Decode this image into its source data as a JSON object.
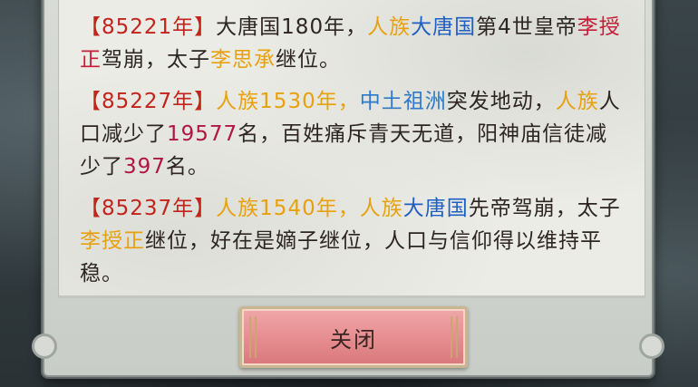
{
  "entries": [
    {
      "segments": [
        {
          "text": "【85221年】",
          "style": "yr"
        },
        {
          "text": "大唐国180年，",
          "style": "plain"
        },
        {
          "text": "人族",
          "style": "race"
        },
        {
          "text": "大唐国",
          "style": "nation"
        },
        {
          "text": "第4世皇帝",
          "style": "plain"
        },
        {
          "text": "李授正",
          "style": "person"
        },
        {
          "text": "驾崩，太子",
          "style": "plain"
        },
        {
          "text": "李思承",
          "style": "race"
        },
        {
          "text": "继位。",
          "style": "plain"
        }
      ]
    },
    {
      "segments": [
        {
          "text": "【85227年】",
          "style": "yr"
        },
        {
          "text": "人族1530年，",
          "style": "race"
        },
        {
          "text": "中土祖洲",
          "style": "land"
        },
        {
          "text": "突发地动，",
          "style": "plain"
        },
        {
          "text": "人族",
          "style": "race"
        },
        {
          "text": "人口减少了",
          "style": "plain"
        },
        {
          "text": "19577",
          "style": "num"
        },
        {
          "text": "名，百姓痛斥青天无道，阳神庙信徒减少了",
          "style": "plain"
        },
        {
          "text": "397",
          "style": "num"
        },
        {
          "text": "名。",
          "style": "plain"
        }
      ]
    },
    {
      "segments": [
        {
          "text": "【85237年】",
          "style": "yr"
        },
        {
          "text": "人族1540年，",
          "style": "race"
        },
        {
          "text": "人族",
          "style": "race"
        },
        {
          "text": "大唐国",
          "style": "nation"
        },
        {
          "text": "先帝驾崩，太子",
          "style": "plain"
        },
        {
          "text": "李授正",
          "style": "race"
        },
        {
          "text": "继位，好在是嫡子继位，人口与信仰得以维持平稳。",
          "style": "plain"
        }
      ]
    }
  ],
  "close_button": {
    "label": "关闭"
  }
}
